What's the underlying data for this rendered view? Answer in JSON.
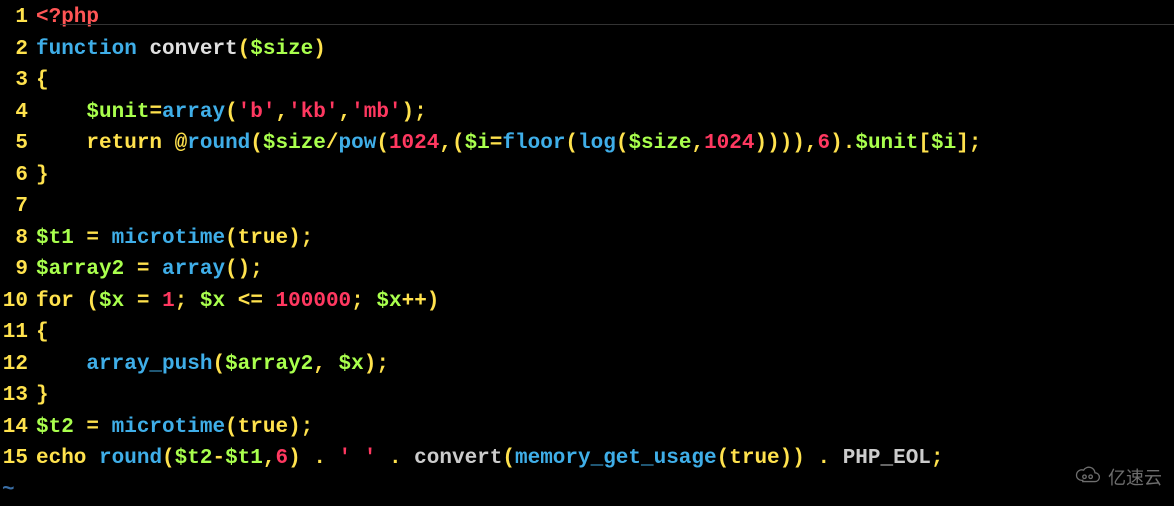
{
  "language": "php",
  "lines": [
    {
      "n": 1,
      "tokens": [
        {
          "t": "<?php",
          "c": "c-tag"
        }
      ]
    },
    {
      "n": 2,
      "tokens": [
        {
          "t": "function",
          "c": "c-builtin"
        },
        {
          "t": " ",
          "c": "c-fn"
        },
        {
          "t": "convert",
          "c": "c-fn"
        },
        {
          "t": "(",
          "c": "c-punc"
        },
        {
          "t": "$size",
          "c": "c-lime"
        },
        {
          "t": ")",
          "c": "c-punc"
        }
      ]
    },
    {
      "n": 3,
      "tokens": [
        {
          "t": "{",
          "c": "c-brace"
        }
      ]
    },
    {
      "n": 4,
      "tokens": [
        {
          "t": "    ",
          "c": "c-fn"
        },
        {
          "t": "$unit",
          "c": "c-lime"
        },
        {
          "t": "=",
          "c": "c-op"
        },
        {
          "t": "array",
          "c": "c-builtin"
        },
        {
          "t": "(",
          "c": "c-punc"
        },
        {
          "t": "'b'",
          "c": "c-str"
        },
        {
          "t": ",",
          "c": "c-punc"
        },
        {
          "t": "'kb'",
          "c": "c-str"
        },
        {
          "t": ",",
          "c": "c-punc"
        },
        {
          "t": "'mb'",
          "c": "c-str"
        },
        {
          "t": ");",
          "c": "c-punc"
        }
      ]
    },
    {
      "n": 5,
      "tokens": [
        {
          "t": "    ",
          "c": "c-fn"
        },
        {
          "t": "return",
          "c": "c-var"
        },
        {
          "t": " @",
          "c": "c-punc"
        },
        {
          "t": "round",
          "c": "c-teal"
        },
        {
          "t": "(",
          "c": "c-punc"
        },
        {
          "t": "$size",
          "c": "c-lime"
        },
        {
          "t": "/",
          "c": "c-op"
        },
        {
          "t": "pow",
          "c": "c-teal"
        },
        {
          "t": "(",
          "c": "c-punc"
        },
        {
          "t": "1024",
          "c": "c-num"
        },
        {
          "t": ",(",
          "c": "c-punc"
        },
        {
          "t": "$i",
          "c": "c-lime"
        },
        {
          "t": "=",
          "c": "c-op"
        },
        {
          "t": "floor",
          "c": "c-teal"
        },
        {
          "t": "(",
          "c": "c-punc"
        },
        {
          "t": "log",
          "c": "c-teal"
        },
        {
          "t": "(",
          "c": "c-punc"
        },
        {
          "t": "$size",
          "c": "c-lime"
        },
        {
          "t": ",",
          "c": "c-punc"
        },
        {
          "t": "1024",
          "c": "c-num"
        },
        {
          "t": ")))),",
          "c": "c-punc"
        },
        {
          "t": "6",
          "c": "c-num"
        },
        {
          "t": ").",
          "c": "c-punc"
        },
        {
          "t": "$unit",
          "c": "c-lime"
        },
        {
          "t": "[",
          "c": "c-punc"
        },
        {
          "t": "$i",
          "c": "c-lime"
        },
        {
          "t": "];",
          "c": "c-punc"
        }
      ]
    },
    {
      "n": 6,
      "tokens": [
        {
          "t": "}",
          "c": "c-brace"
        }
      ]
    },
    {
      "n": 7,
      "tokens": [
        {
          "t": "",
          "c": "c-fn"
        }
      ]
    },
    {
      "n": 8,
      "tokens": [
        {
          "t": "$t1",
          "c": "c-lime"
        },
        {
          "t": " = ",
          "c": "c-op"
        },
        {
          "t": "microtime",
          "c": "c-teal"
        },
        {
          "t": "(",
          "c": "c-punc"
        },
        {
          "t": "true",
          "c": "c-var"
        },
        {
          "t": ");",
          "c": "c-punc"
        }
      ]
    },
    {
      "n": 9,
      "tokens": [
        {
          "t": "$array2",
          "c": "c-lime"
        },
        {
          "t": " = ",
          "c": "c-op"
        },
        {
          "t": "array",
          "c": "c-builtin"
        },
        {
          "t": "();",
          "c": "c-punc"
        }
      ]
    },
    {
      "n": 10,
      "tokens": [
        {
          "t": "for",
          "c": "c-var"
        },
        {
          "t": " (",
          "c": "c-punc"
        },
        {
          "t": "$x",
          "c": "c-lime"
        },
        {
          "t": " = ",
          "c": "c-op"
        },
        {
          "t": "1",
          "c": "c-num"
        },
        {
          "t": "; ",
          "c": "c-punc"
        },
        {
          "t": "$x",
          "c": "c-lime"
        },
        {
          "t": " <= ",
          "c": "c-op"
        },
        {
          "t": "100000",
          "c": "c-num"
        },
        {
          "t": "; ",
          "c": "c-punc"
        },
        {
          "t": "$x",
          "c": "c-lime"
        },
        {
          "t": "++)",
          "c": "c-punc"
        }
      ]
    },
    {
      "n": 11,
      "tokens": [
        {
          "t": "{",
          "c": "c-brace"
        }
      ]
    },
    {
      "n": 12,
      "tokens": [
        {
          "t": "    ",
          "c": "c-fn"
        },
        {
          "t": "array_push",
          "c": "c-teal"
        },
        {
          "t": "(",
          "c": "c-punc"
        },
        {
          "t": "$array2",
          "c": "c-lime"
        },
        {
          "t": ", ",
          "c": "c-punc"
        },
        {
          "t": "$x",
          "c": "c-lime"
        },
        {
          "t": ");",
          "c": "c-punc"
        }
      ]
    },
    {
      "n": 13,
      "tokens": [
        {
          "t": "}",
          "c": "c-brace"
        }
      ]
    },
    {
      "n": 14,
      "tokens": [
        {
          "t": "$t2",
          "c": "c-lime"
        },
        {
          "t": " = ",
          "c": "c-op"
        },
        {
          "t": "microtime",
          "c": "c-teal"
        },
        {
          "t": "(",
          "c": "c-punc"
        },
        {
          "t": "true",
          "c": "c-var"
        },
        {
          "t": ");",
          "c": "c-punc"
        }
      ]
    },
    {
      "n": 15,
      "tokens": [
        {
          "t": "echo",
          "c": "c-var"
        },
        {
          "t": " ",
          "c": "c-fn"
        },
        {
          "t": "round",
          "c": "c-teal"
        },
        {
          "t": "(",
          "c": "c-punc"
        },
        {
          "t": "$t2",
          "c": "c-lime"
        },
        {
          "t": "-",
          "c": "c-op"
        },
        {
          "t": "$t1",
          "c": "c-lime"
        },
        {
          "t": ",",
          "c": "c-punc"
        },
        {
          "t": "6",
          "c": "c-num"
        },
        {
          "t": ") . ",
          "c": "c-punc"
        },
        {
          "t": "' '",
          "c": "c-str"
        },
        {
          "t": " . ",
          "c": "c-punc"
        },
        {
          "t": "convert",
          "c": "c-white"
        },
        {
          "t": "(",
          "c": "c-punc"
        },
        {
          "t": "memory_get_usage",
          "c": "c-teal"
        },
        {
          "t": "(",
          "c": "c-punc"
        },
        {
          "t": "true",
          "c": "c-var"
        },
        {
          "t": "))",
          "c": "c-punc"
        },
        {
          "t": " . ",
          "c": "c-punc"
        },
        {
          "t": "PHP_EOL",
          "c": "c-white"
        },
        {
          "t": ";",
          "c": "c-punc"
        }
      ]
    }
  ],
  "tilde": "~",
  "watermark_text": "亿速云"
}
